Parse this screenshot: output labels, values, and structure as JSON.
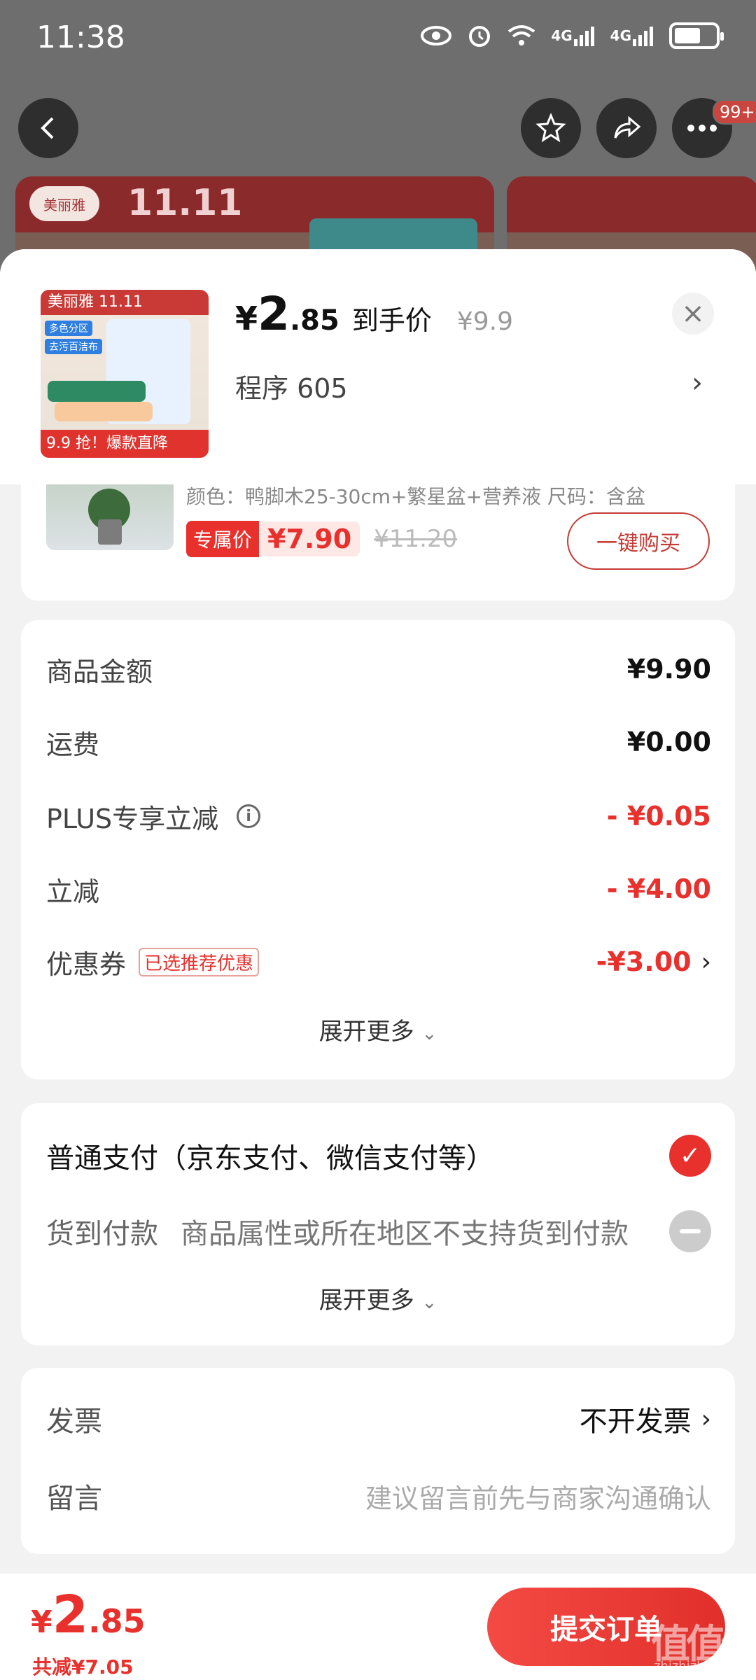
{
  "status": {
    "time": "11:38",
    "network_1": "4G",
    "network_2": "4G",
    "icons": [
      "eye-icon",
      "alarm-icon",
      "wifi-icon",
      "signal-icon",
      "signal-icon",
      "battery-icon"
    ]
  },
  "nav": {
    "badge": "99+",
    "icons": [
      "back-icon",
      "star-icon",
      "share-icon",
      "more-icon"
    ]
  },
  "banner": {
    "brand": "美丽雅",
    "event": "11.11"
  },
  "product": {
    "price_symbol": "¥",
    "price_int": "2",
    "price_dec": ".85",
    "price_label": "到手价",
    "original_price": "¥9.9",
    "spec": "程序  605",
    "thumb_brand": "美丽雅 11.11",
    "thumb_tag1": "多色分区",
    "thumb_tag2": "去污百洁布",
    "thumb_bottom": "9.9 抢！爆款直降"
  },
  "recommend": {
    "desc": "颜色：鸭脚木25-30cm+繁星盆+营养液  尺码：含盆",
    "excl_tag": "专属价",
    "excl_price": "¥7.90",
    "old_price": "¥11.20",
    "buy_label": "一键购买"
  },
  "summary": {
    "rows": [
      {
        "label": "商品金额",
        "value": "¥9.90"
      },
      {
        "label": "运费",
        "value": "¥0.00"
      },
      {
        "label": "PLUS专享立减",
        "value": "- ¥0.05"
      },
      {
        "label": "立减",
        "value": "- ¥4.00"
      },
      {
        "label": "优惠券",
        "tag": "已选推荐优惠",
        "value": "-¥3.00"
      }
    ],
    "expand": "展开更多"
  },
  "payment": {
    "normal_label": "普通支付（京东支付、微信支付等）",
    "cod_label": "货到付款",
    "cod_note": "商品属性或所在地区不支持货到付款",
    "expand": "展开更多"
  },
  "invoice": {
    "label": "发票",
    "value": "不开发票",
    "message_label": "留言",
    "message_placeholder": "建议留言前先与商家沟通确认"
  },
  "bottom": {
    "price_symbol": "¥",
    "price_int": "2",
    "price_dec": ".85",
    "saved": "共减¥7.05",
    "submit": "提交订单",
    "watermark": "值值值",
    "watermark_sub": "zhizhizhi.com"
  },
  "colors": {
    "accent": "#e8302c",
    "overlay": "#6e6e6e"
  }
}
